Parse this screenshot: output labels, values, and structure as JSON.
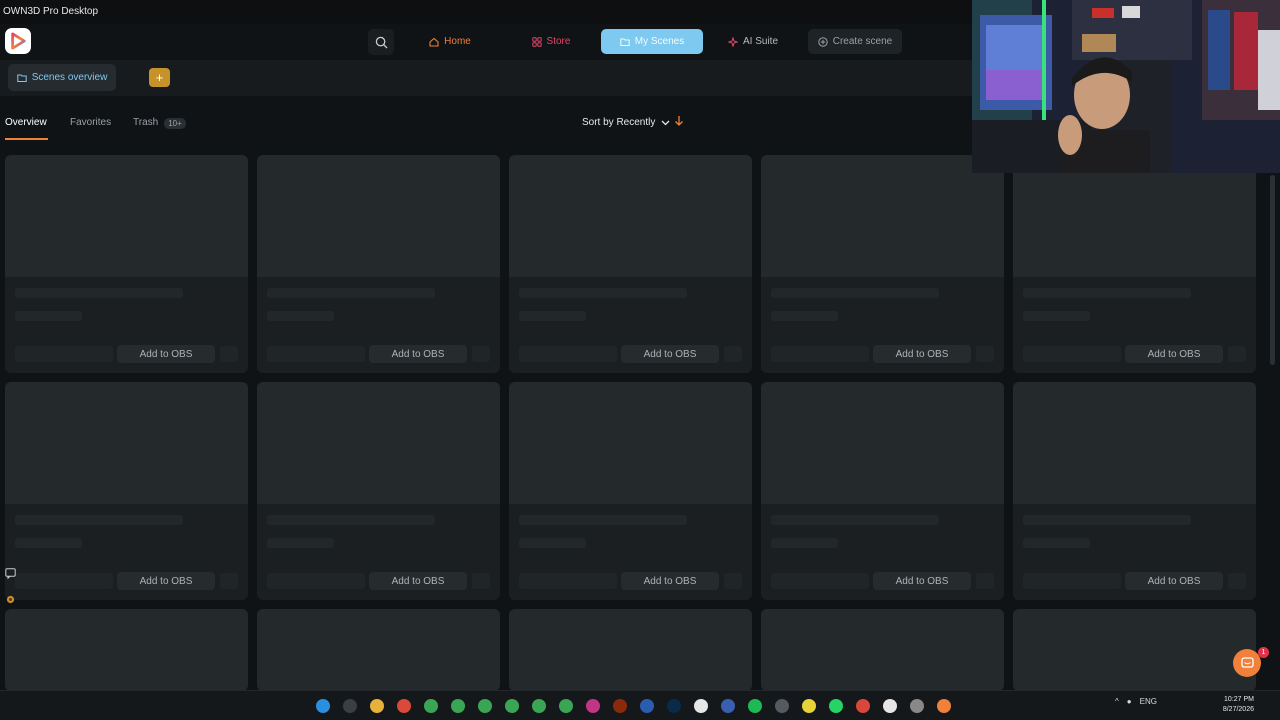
{
  "window": {
    "title": "OWN3D Pro Desktop"
  },
  "nav": {
    "home": "Home",
    "store": "Store",
    "my_scenes": "My Scenes",
    "ai_suite": "AI Suite",
    "create_scene": "Create scene"
  },
  "subbar": {
    "scenes_overview": "Scenes overview",
    "add": "+"
  },
  "tabs": {
    "overview": "Overview",
    "favorites": "Favorites",
    "trash": "Trash",
    "trash_count": "10+"
  },
  "sort": {
    "label": "Sort by Recently"
  },
  "cards": {
    "button_label": "Add to OBS",
    "rows": 3,
    "columns": 5
  },
  "chat": {
    "badge": "1"
  },
  "taskbar": {
    "language": "ENG",
    "time": "10:27 PM",
    "date": "8/27/2026"
  },
  "colors": {
    "accent_orange": "#f0803a",
    "accent_pink": "#e2466a",
    "my_scenes_bg": "#7ec9ef",
    "add_button": "#c8922a",
    "background": "#101315"
  }
}
